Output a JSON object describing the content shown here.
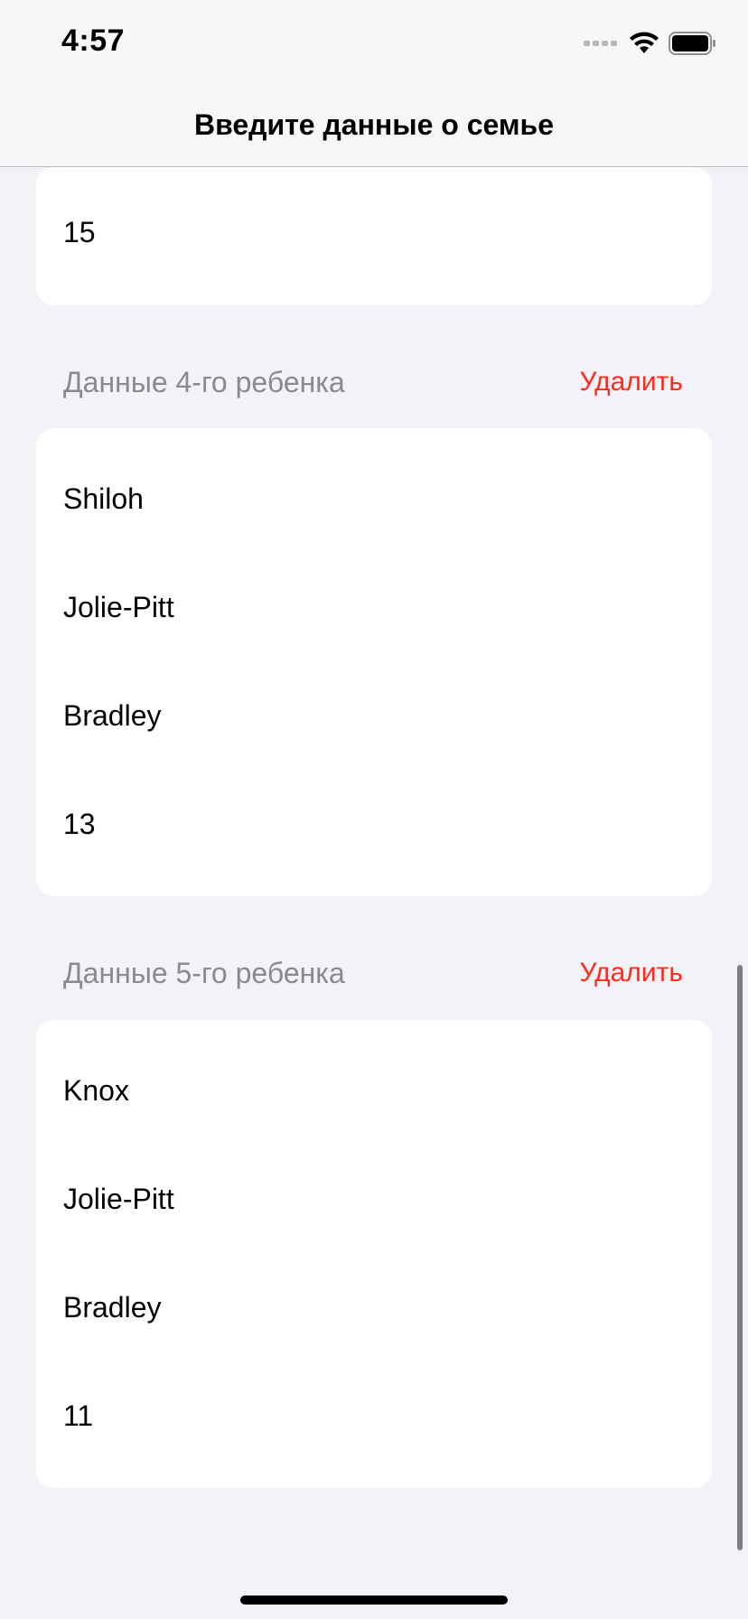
{
  "status_bar": {
    "time": "4:57",
    "icons": [
      "signal-icon",
      "wifi-icon",
      "battery-icon"
    ]
  },
  "nav": {
    "title": "Введите данные о семье"
  },
  "top_card": {
    "value": "15"
  },
  "children": [
    {
      "header": "Данные 4-го ребенка",
      "delete_label": "Удалить",
      "first_name": "Shiloh",
      "last_name": "Jolie-Pitt",
      "middle_name": "Bradley",
      "age": "13"
    },
    {
      "header": "Данные 5-го ребенка",
      "delete_label": "Удалить",
      "first_name": "Knox",
      "last_name": "Jolie-Pitt",
      "middle_name": "Bradley",
      "age": "11"
    }
  ],
  "colors": {
    "background": "#f2f2f7",
    "card": "#ffffff",
    "delete": "#ff2a1d",
    "header_text": "#8a8a8e"
  }
}
